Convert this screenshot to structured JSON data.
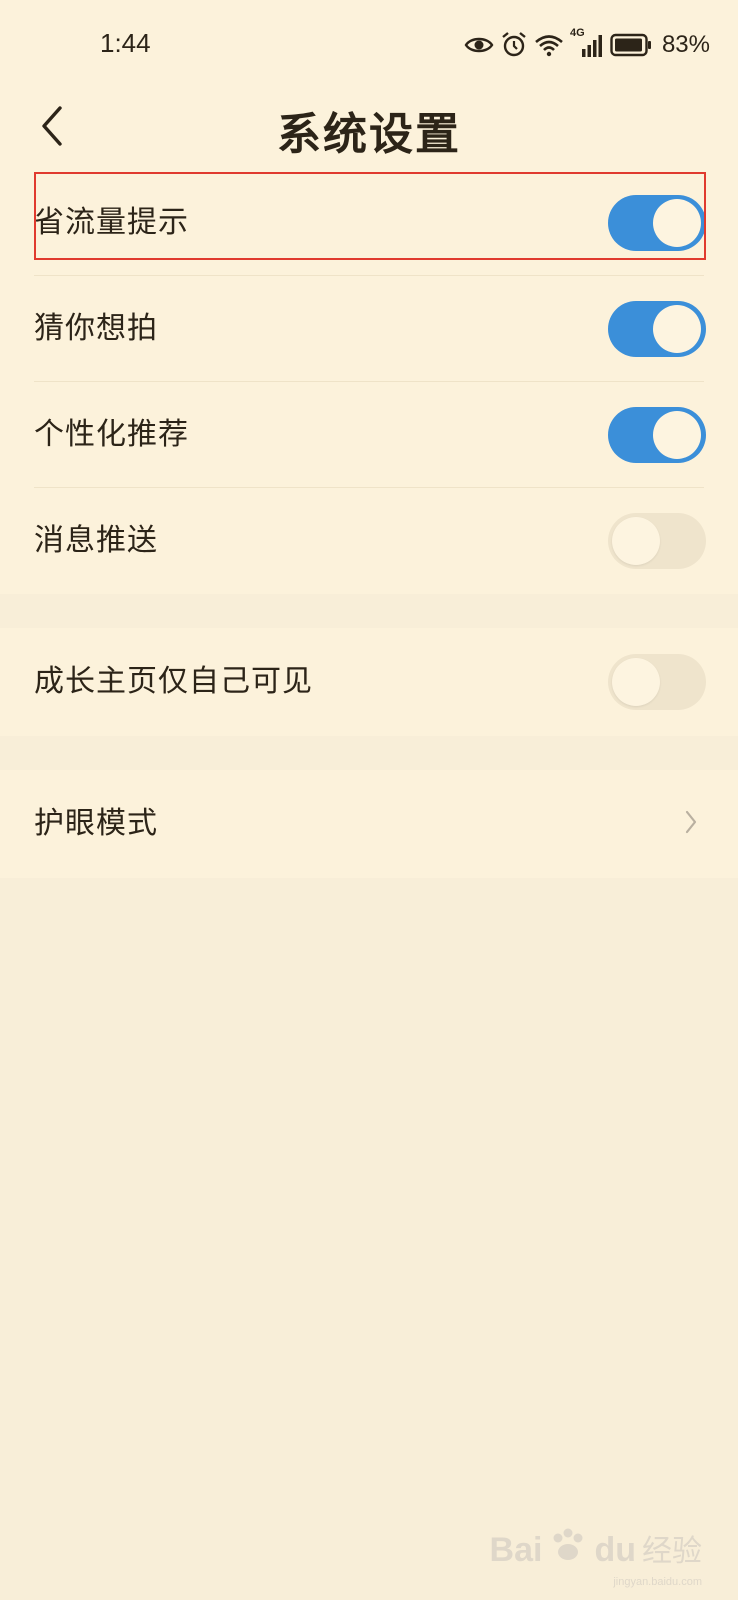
{
  "status_bar": {
    "time": "1:44",
    "network": "4G",
    "battery_percent": "83%",
    "icons": [
      "eye-icon",
      "alarm-icon",
      "wifi-icon",
      "signal-icon",
      "battery-icon"
    ]
  },
  "header": {
    "title": "系统设置",
    "back_icon": "chevron-left-icon"
  },
  "settings": {
    "group1": [
      {
        "label": "省流量提示",
        "enabled": true
      },
      {
        "label": "猜你想拍",
        "enabled": true
      },
      {
        "label": "个性化推荐",
        "enabled": true
      },
      {
        "label": "消息推送",
        "enabled": false
      }
    ],
    "group2": [
      {
        "label": "成长主页仅自己可见",
        "enabled": false
      }
    ],
    "group3": [
      {
        "label": "护眼模式",
        "icon": "chevron-right-icon"
      }
    ]
  },
  "watermark": {
    "brand": "Bai",
    "brand2": "du",
    "cn": "经验",
    "url": "jingyan.baidu.com"
  },
  "colors": {
    "background": "#f8eed8",
    "panel": "#fcf2db",
    "toggle_on": "#3b8fd9",
    "toggle_off": "#efe4cc",
    "highlight": "#e03a2e"
  }
}
